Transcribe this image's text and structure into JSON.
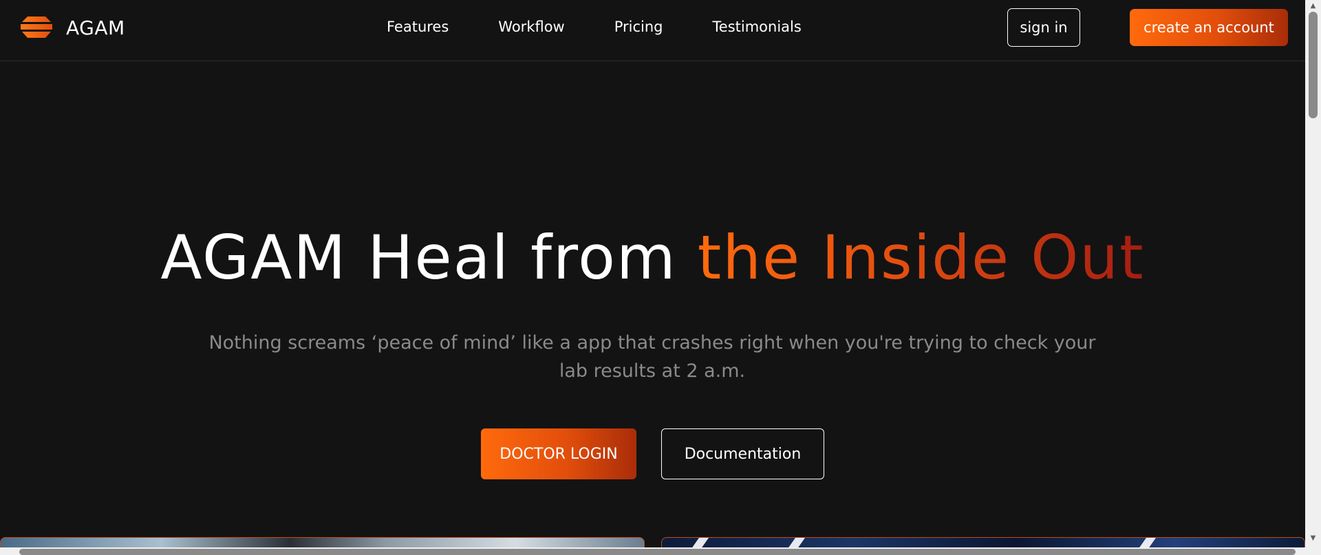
{
  "header": {
    "brand_name": "AGAM",
    "logo_icon": "stacked-layers-logo",
    "nav": [
      {
        "label": "Features"
      },
      {
        "label": "Workflow"
      },
      {
        "label": "Pricing"
      },
      {
        "label": "Testimonials"
      }
    ],
    "signin_label": "sign in",
    "create_account_label": "create an account"
  },
  "hero": {
    "title_plain": "AGAM Heal from ",
    "title_accent": "the Inside Out",
    "subtitle": "Nothing screams ‘peace of mind’ like a app that crashes right when you're trying to check your lab results at 2 a.m.",
    "primary_button": "DOCTOR LOGIN",
    "secondary_button": "Documentation"
  },
  "colors": {
    "background": "#131313",
    "accent_start": "#ff6a0d",
    "accent_end": "#a41d12",
    "subtitle_text": "#8a8a8a"
  }
}
